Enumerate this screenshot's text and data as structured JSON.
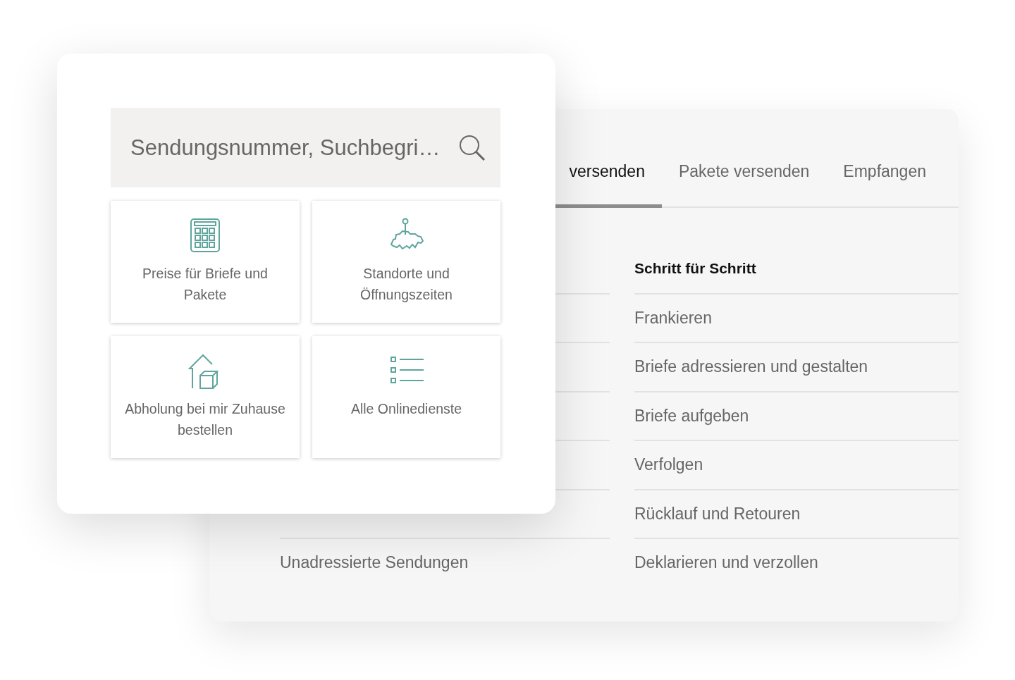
{
  "search": {
    "placeholder": "Sendungsnummer, Suchbegri…"
  },
  "tiles": [
    {
      "kind": "prices",
      "label": "Preise für Briefe und Pakete"
    },
    {
      "kind": "locations",
      "label": "Standorte und Öffnungszeiten"
    },
    {
      "kind": "pickup",
      "label": "Abholung bei mir Zuhause bestellen"
    },
    {
      "kind": "services",
      "label": "Alle Onlinedienste"
    }
  ],
  "tabs": [
    {
      "label": "versenden",
      "selected": true
    },
    {
      "label": "Pakete versenden",
      "selected": false
    },
    {
      "label": "Empfangen",
      "selected": false
    }
  ],
  "left_list": {
    "items": [
      "Unadressierte Sendungen"
    ]
  },
  "steps": {
    "title": "Schritt für Schritt",
    "items": [
      "Frankieren",
      "Briefe adressieren und gestalten",
      "Briefe aufgeben",
      "Verfolgen",
      "Rücklauf und Retouren",
      "Deklarieren und verzollen"
    ]
  }
}
